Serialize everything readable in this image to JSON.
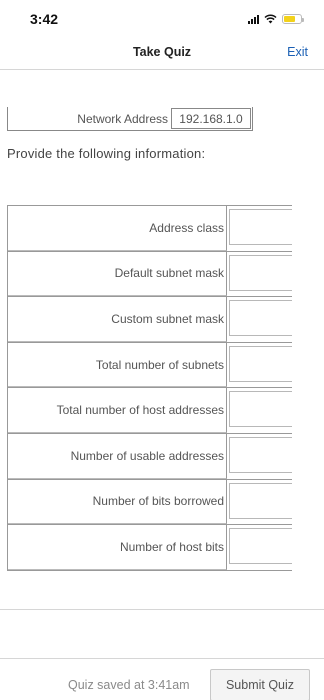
{
  "status_bar": {
    "time": "3:42",
    "icons": [
      "signal-icon",
      "wifi-icon",
      "battery-icon"
    ]
  },
  "header": {
    "title": "Take Quiz",
    "exit_label": "Exit"
  },
  "network_address": {
    "label": "Network Address",
    "value": "192.168.1.0"
  },
  "prompt": "Provide the following information:",
  "questions": [
    {
      "label": "Address class",
      "value": ""
    },
    {
      "label": "Default subnet mask",
      "value": ""
    },
    {
      "label": "Custom subnet mask",
      "value": ""
    },
    {
      "label": "Total number of subnets",
      "value": ""
    },
    {
      "label": "Total number of host addresses",
      "value": ""
    },
    {
      "label": "Number of usable addresses",
      "value": ""
    },
    {
      "label": "Number of bits borrowed",
      "value": ""
    },
    {
      "label": "Number of host bits",
      "value": ""
    }
  ],
  "footer": {
    "saved_text": "Quiz saved at 3:41am",
    "submit_label": "Submit Quiz"
  },
  "colors": {
    "link": "#1a5fb4",
    "battery": "#f3d21b"
  }
}
